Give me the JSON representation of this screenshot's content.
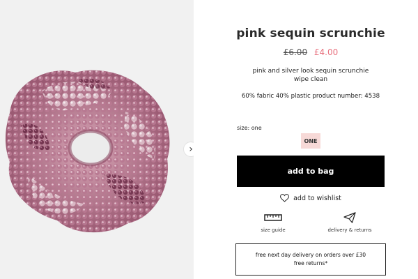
{
  "product": {
    "title": "pink sequin scrunchie",
    "old_price": "£6.00",
    "new_price": "£4.00",
    "description_line1": "pink and silver look sequin scrunchie",
    "description_line2": "wipe clean",
    "composition": "60% fabric 40% plastic product number: 4538"
  },
  "size": {
    "label": "size: one",
    "option": "ONE"
  },
  "actions": {
    "add_to_bag": "add to bag",
    "add_to_wishlist": "add to wishlist",
    "size_guide": "size guide",
    "delivery_returns": "delivery & returns"
  },
  "gallery": {
    "next_icon": "›"
  },
  "promo": {
    "line1": "free next day delivery on orders over £30",
    "line2": "free returns*"
  },
  "icons": {
    "heart": "heart-icon",
    "ruler": "ruler-icon",
    "paper_plane": "paper-plane-icon",
    "next": "chevron-right-icon"
  },
  "colors": {
    "sale_price": "#e8727f",
    "size_chip": "#f7d9d7",
    "button": "#000000",
    "image_bg": "#f1f1f1"
  }
}
